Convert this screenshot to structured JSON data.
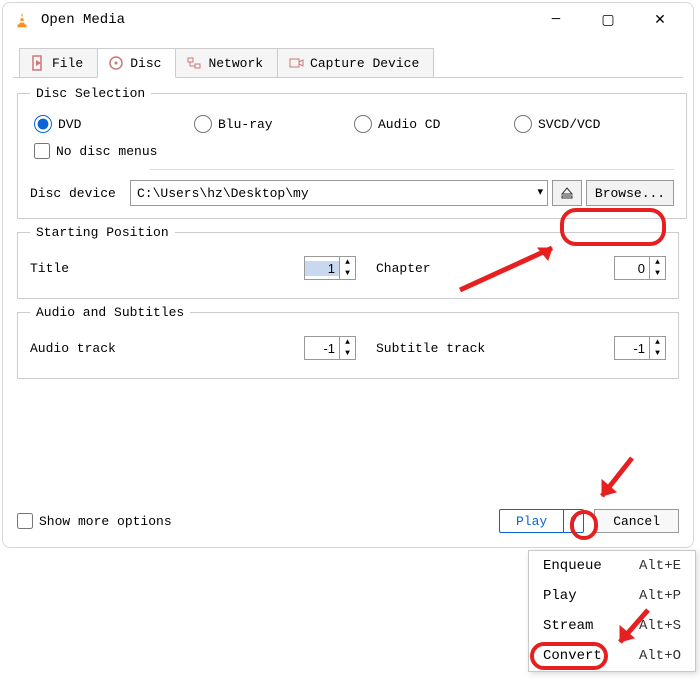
{
  "window": {
    "title": "Open Media"
  },
  "tabs": {
    "file": "File",
    "disc": "Disc",
    "network": "Network",
    "capture": "Capture Device"
  },
  "disc_selection": {
    "legend": "Disc Selection",
    "dvd": "DVD",
    "bluray": "Blu-ray",
    "audiocd": "Audio CD",
    "svcd": "SVCD/VCD",
    "no_menus": "No disc menus",
    "device_label": "Disc device",
    "device_path": "C:\\Users\\hz\\Desktop\\my",
    "browse": "Browse..."
  },
  "starting_position": {
    "legend": "Starting Position",
    "title_label": "Title",
    "title_value": "1",
    "chapter_label": "Chapter",
    "chapter_value": "0"
  },
  "audio_subtitles": {
    "legend": "Audio and Subtitles",
    "audio_label": "Audio track",
    "audio_value": "-1",
    "subtitle_label": "Subtitle track",
    "subtitle_value": "-1"
  },
  "footer": {
    "show_more": "Show more options",
    "play": "Play",
    "cancel": "Cancel"
  },
  "menu": {
    "enqueue": {
      "label": "Enqueue",
      "shortcut": "Alt+E"
    },
    "play": {
      "label": "Play",
      "shortcut": "Alt+P"
    },
    "stream": {
      "label": "Stream",
      "shortcut": "Alt+S"
    },
    "convert": {
      "label": "Convert",
      "shortcut": "Alt+O"
    }
  }
}
